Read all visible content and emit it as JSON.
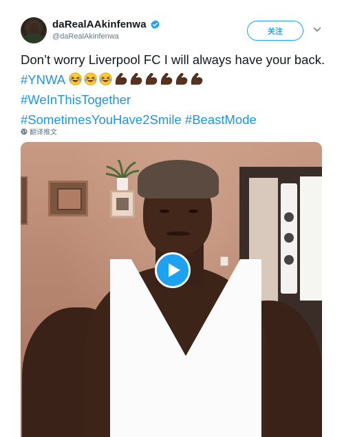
{
  "author": {
    "display_name": "daRealAAkinfenwa",
    "handle": "@daRealAkinfenwa",
    "verified": true
  },
  "follow_label": "关注",
  "tweet": {
    "text_start": "Don’t worry Liverpool FC I will always have your back. ",
    "hashtag_1": "#YNWA",
    "emojis": [
      "rolling-on-floor-laughing",
      "rolling-on-floor-laughing",
      "rolling-on-floor-laughing",
      "flexed-biceps",
      "flexed-biceps",
      "flexed-biceps",
      "flexed-biceps",
      "flexed-biceps",
      "flexed-biceps"
    ],
    "hashtag_2": "#WeInThisTogether",
    "hashtag_3": "#SometimesYouHave2Smile",
    "hashtag_4": "#BeastMode"
  },
  "translate_label": "翻译推文",
  "colors": {
    "link": "#1b95e0",
    "accent": "#1da1f2",
    "text": "#14171a",
    "muted": "#657786"
  }
}
